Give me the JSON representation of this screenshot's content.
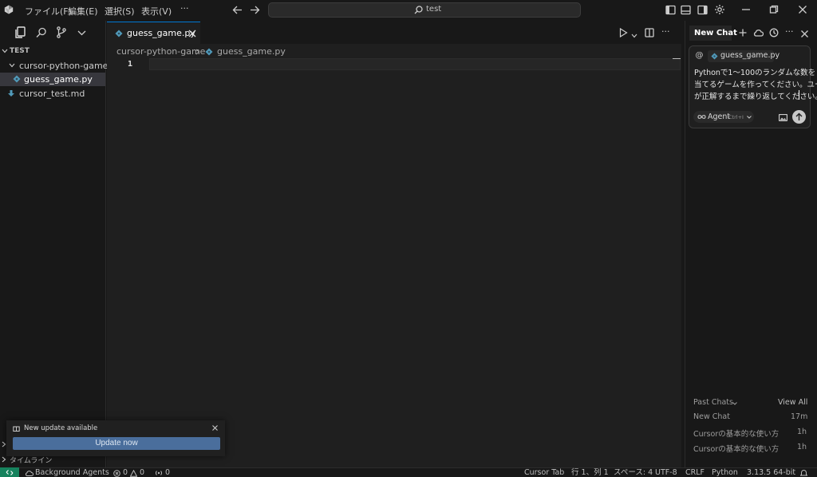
{
  "menu": {
    "file": "ファイル(F)",
    "edit": "編集(E)",
    "selection": "選択(S)",
    "view": "表示(V)",
    "more": "···"
  },
  "search": {
    "value": "test"
  },
  "sidebar": {
    "section": "TEST",
    "folder": "cursor-python-game",
    "file1": "guess_game.py",
    "file2": "cursor_test.md",
    "timeline": "タイムライン"
  },
  "editor": {
    "tab_label": "guess_game.py",
    "breadcrumb_folder": "cursor-python-game",
    "breadcrumb_file": "guess_game.py",
    "line_number": "1"
  },
  "chat": {
    "tab_label": "New Chat",
    "context_file": "guess_game.py",
    "prompt_lines": [
      "Pythonで1〜100のランダムな数を",
      "当てるゲームを作ってください。ユーザー",
      "が正解するまで繰り返してください。"
    ],
    "mode_label": "Agent",
    "mode_shortcut": "Ctrl+I",
    "past_chats_label": "Past Chats",
    "view_all": "View All",
    "history": [
      {
        "title": "New Chat",
        "time": "17m"
      },
      {
        "title": "Cursorの基本的な使い方",
        "time": "1h"
      },
      {
        "title": "Cursorの基本的な使い方",
        "time": "1h"
      }
    ]
  },
  "notification": {
    "message": "New update available",
    "button": "Update now"
  },
  "status": {
    "background_agents": "Background Agents",
    "errors": "0",
    "warnings": "0",
    "ports": "0",
    "cursor_tab": "Cursor Tab",
    "position": "行 1、列 1",
    "spaces": "スペース: 4",
    "encoding": "UTF-8",
    "eol": "CRLF",
    "language": "Python",
    "interpreter": "3.13.5 64-bit"
  },
  "colors": {
    "accent": "#0078d4",
    "python_icon": "#519aba",
    "remote": "#16825d",
    "update_button": "#4a6e9c"
  }
}
